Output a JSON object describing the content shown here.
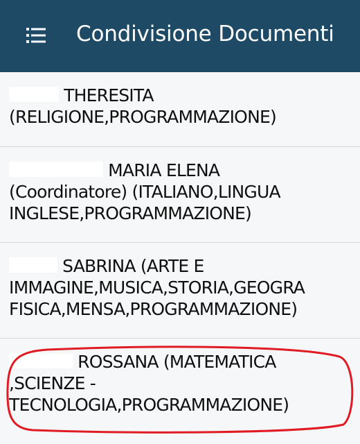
{
  "header": {
    "menu_icon": "hamburger-icon",
    "title": "Condivisione Documenti",
    "background": "#1f4a66"
  },
  "teachers": [
    {
      "name_shown": "THERESITA",
      "line1_rest": "THERESITA",
      "line2": "(RELIGIONE,PROGRAMMAZIONE)"
    },
    {
      "name_shown": "MARIA ELENA",
      "line1_rest": "MARIA ELENA",
      "line2": "(Coordinatore) (ITALIANO,LINGUA",
      "line3": "INGLESE,PROGRAMMAZIONE)"
    },
    {
      "name_shown": "SABRINA",
      "line1_rest": "SABRINA (ARTE E",
      "line2": "IMMAGINE,MUSICA,STORIA,GEOGRA",
      "line3": "FISICA,MENSA,PROGRAMMAZIONE)"
    },
    {
      "name_shown": "ROSSANA",
      "line1_rest": "ROSSANA (MATEMATICA",
      "line2": ",SCIENZE -",
      "line3": "TECNOLOGIA,PROGRAMMAZIONE)",
      "highlighted": true
    }
  ],
  "highlight_color": "#e01b24"
}
